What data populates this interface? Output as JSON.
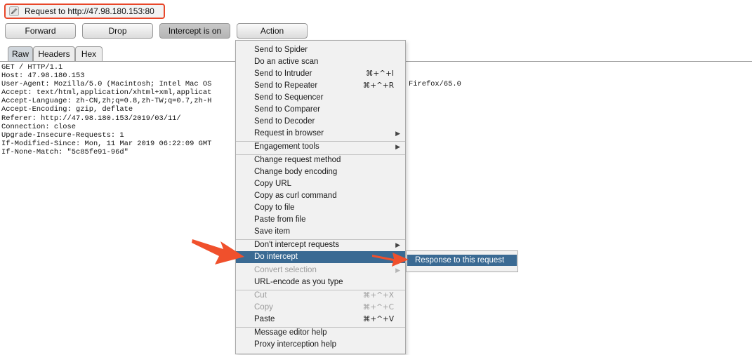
{
  "window": {
    "title": "Request to http://47.98.180.153:80"
  },
  "toolbar": {
    "forward": "Forward",
    "drop": "Drop",
    "intercept": "Intercept is on",
    "action": "Action"
  },
  "tabs": [
    "Raw",
    "Headers",
    "Hex"
  ],
  "request_lines": [
    "GET / HTTP/1.1",
    "Host: 47.98.180.153",
    "User-Agent: Mozilla/5.0 (Macintosh; Intel Mac OS",
    "Accept: text/html,application/xhtml+xml,applicat",
    "Accept-Language: zh-CN,zh;q=0.8,zh-TW;q=0.7,zh-H",
    "Accept-Encoding: gzip, deflate",
    "Referer: http://47.98.180.153/2019/03/11/",
    "Connection: close",
    "Upgrade-Insecure-Requests: 1",
    "If-Modified-Since: Mon, 11 Mar 2019 06:22:09 GMT",
    "If-None-Match: \"5c85fe91-96d\""
  ],
  "request_partial_right": "Firefox/65.0",
  "menu": {
    "send_to_spider": "Send to Spider",
    "do_active_scan": "Do an active scan",
    "send_to_intruder": "Send to Intruder",
    "send_to_intruder_shortcut": "⌘+^+I",
    "send_to_repeater": "Send to Repeater",
    "send_to_repeater_shortcut": "⌘+^+R",
    "send_to_sequencer": "Send to Sequencer",
    "send_to_comparer": "Send to Comparer",
    "send_to_decoder": "Send to Decoder",
    "request_in_browser": "Request in browser",
    "engagement_tools": "Engagement tools",
    "change_request_method": "Change request method",
    "change_body_encoding": "Change body encoding",
    "copy_url": "Copy URL",
    "copy_as_curl": "Copy as curl command",
    "copy_to_file": "Copy to file",
    "paste_from_file": "Paste from file",
    "save_item": "Save item",
    "dont_intercept": "Don't intercept requests",
    "do_intercept": "Do intercept",
    "convert_selection": "Convert selection",
    "url_encode": "URL-encode as you type",
    "cut": "Cut",
    "cut_shortcut": "⌘+^+X",
    "copy": "Copy",
    "copy_shortcut": "⌘+^+C",
    "paste": "Paste",
    "paste_shortcut": "⌘+^+V",
    "message_editor_help": "Message editor help",
    "proxy_interception_help": "Proxy interception help"
  },
  "submenu": {
    "response_to_this_request": "Response to this request"
  },
  "icons": {
    "title": "pencil-icon",
    "submenu_indicator": "triangle-right-icon",
    "callout": "red-arrow-icon"
  },
  "colors": {
    "highlight": "#3a6a93",
    "callout": "#f0502c",
    "title_border": "#e8472a"
  }
}
